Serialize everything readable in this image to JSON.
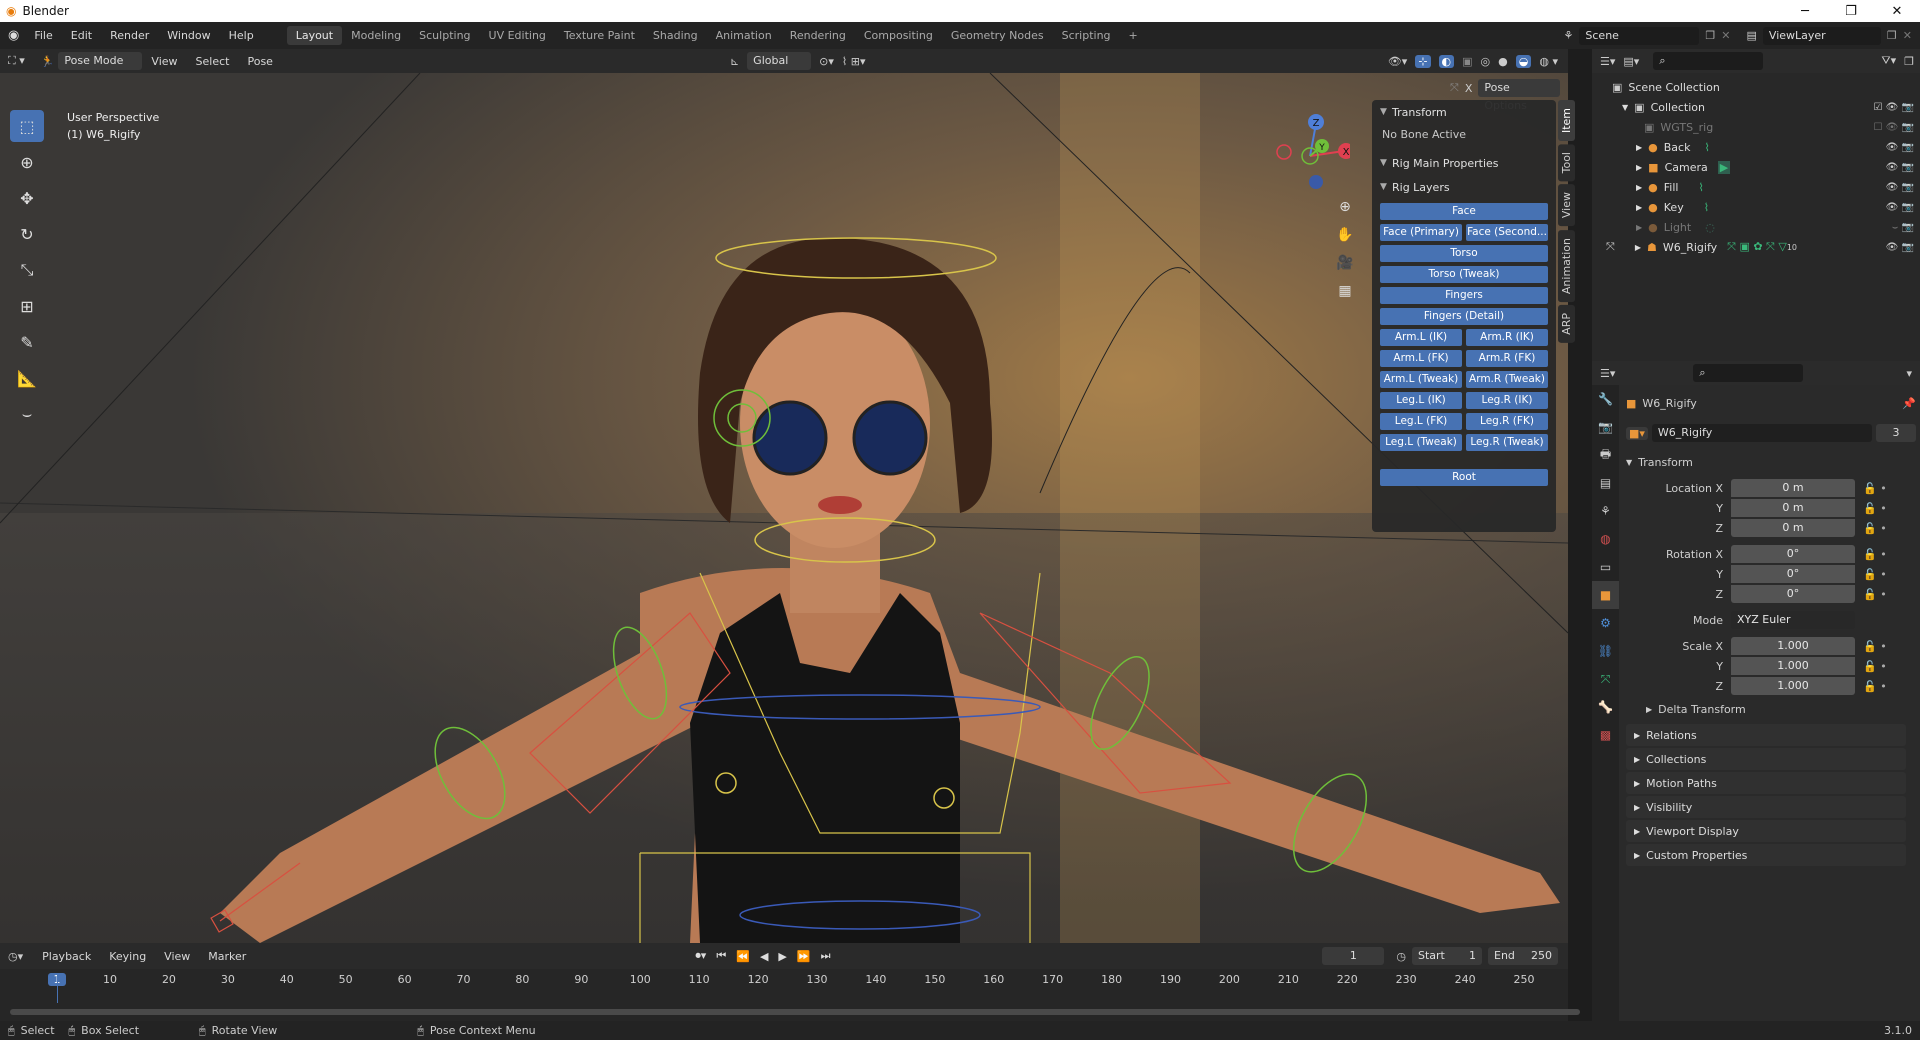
{
  "window": {
    "title": "Blender"
  },
  "menu": [
    "File",
    "Edit",
    "Render",
    "Window",
    "Help"
  ],
  "workspaces": [
    "Layout",
    "Modeling",
    "Sculpting",
    "UV Editing",
    "Texture Paint",
    "Shading",
    "Animation",
    "Rendering",
    "Compositing",
    "Geometry Nodes",
    "Scripting"
  ],
  "active_workspace": "Layout",
  "scene": {
    "name": "Scene",
    "viewlayer": "ViewLayer"
  },
  "viewport_header": {
    "mode": "Pose Mode",
    "menus": [
      "View",
      "Select",
      "Pose"
    ],
    "orientation": "Global",
    "pose_options": "Pose Options"
  },
  "viewport": {
    "perspective": "User Perspective",
    "object": "(1) W6_Rigify"
  },
  "npanel": {
    "transform_title": "Transform",
    "no_bone": "No Bone Active",
    "rig_main": "Rig Main Properties",
    "rig_layers": "Rig Layers",
    "buttons_full": [
      "Face",
      "Torso",
      "Torso (Tweak)",
      "Fingers",
      "Fingers (Detail)"
    ],
    "face_pair": [
      "Face (Primary)",
      "Face (Second..."
    ],
    "pairs": [
      [
        "Arm.L (IK)",
        "Arm.R (IK)"
      ],
      [
        "Arm.L (FK)",
        "Arm.R (FK)"
      ],
      [
        "Arm.L (Tweak)",
        "Arm.R (Tweak)"
      ],
      [
        "Leg.L (IK)",
        "Leg.R (IK)"
      ],
      [
        "Leg.L (FK)",
        "Leg.R (FK)"
      ],
      [
        "Leg.L (Tweak)",
        "Leg.R (Tweak)"
      ]
    ],
    "root": "Root"
  },
  "side_tabs": [
    "Item",
    "Tool",
    "View",
    "Animation",
    "ARP"
  ],
  "outliner": {
    "scene_collection": "Scene Collection",
    "collection": "Collection",
    "items": [
      "WGTS_rig",
      "Back",
      "Camera",
      "Fill",
      "Key",
      "Light",
      "W6_Rigify"
    ],
    "w6_badge": "10"
  },
  "properties": {
    "object_name": "W6_Rigify",
    "datablock": "W6_Rigify",
    "users": "3",
    "transform": "Transform",
    "location": {
      "label": "Location X",
      "x": "0 m",
      "y": "0 m",
      "z": "0 m"
    },
    "rotation": {
      "label": "Rotation X",
      "x": "0°",
      "y": "0°",
      "z": "0°"
    },
    "mode_label": "Mode",
    "mode": "XYZ Euler",
    "scale": {
      "label": "Scale X",
      "x": "1.000",
      "y": "1.000",
      "z": "1.000"
    },
    "axis_y": "Y",
    "axis_z": "Z",
    "delta": "Delta Transform",
    "panels": [
      "Relations",
      "Collections",
      "Motion Paths",
      "Visibility",
      "Viewport Display",
      "Custom Properties"
    ]
  },
  "timeline": {
    "menus": [
      "Playback",
      "Keying",
      "View",
      "Marker"
    ],
    "current_frame": "1",
    "start_label": "Start",
    "start": "1",
    "end_label": "End",
    "end": "250",
    "ticks": [
      "1",
      "10",
      "20",
      "30",
      "40",
      "50",
      "60",
      "70",
      "80",
      "90",
      "100",
      "110",
      "120",
      "130",
      "140",
      "150",
      "160",
      "170",
      "180",
      "190",
      "200",
      "210",
      "220",
      "230",
      "240",
      "250"
    ]
  },
  "status": {
    "select": "Select",
    "box_select": "Box Select",
    "rotate": "Rotate View",
    "context": "Pose Context Menu",
    "version": "3.1.0"
  },
  "colors": {
    "accent": "#4772b3",
    "bg": "#303030"
  }
}
